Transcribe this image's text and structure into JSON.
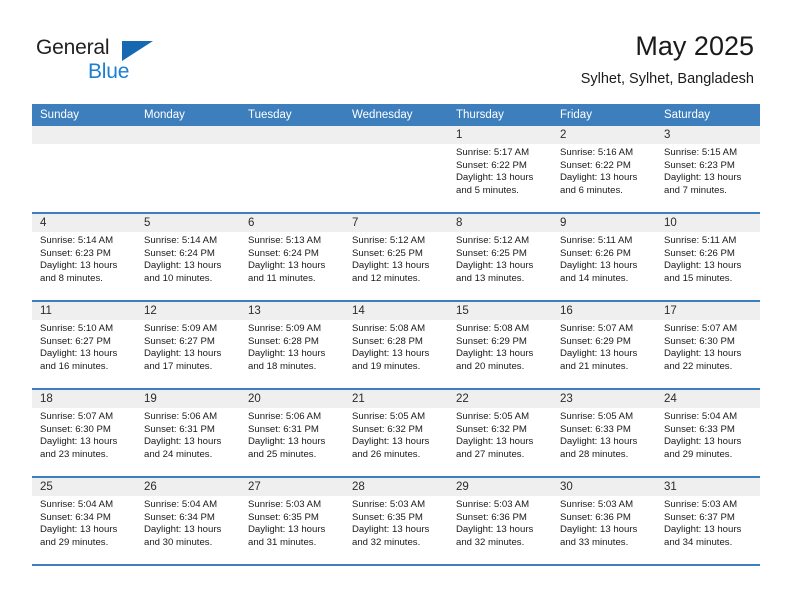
{
  "logo": {
    "word1": "General",
    "word2": "Blue",
    "triangle_color": "#1668b3",
    "blue_color": "#1b7fd4"
  },
  "header": {
    "title": "May 2025",
    "subtitle": "Sylhet, Sylhet, Bangladesh"
  },
  "theme": {
    "header_blue": "#3d7ebd",
    "daynum_strip": "#efefef",
    "cell_bg": "#ffffff"
  },
  "weekdays": [
    "Sunday",
    "Monday",
    "Tuesday",
    "Wednesday",
    "Thursday",
    "Friday",
    "Saturday"
  ],
  "labels": {
    "sunrise": "Sunrise:",
    "sunset": "Sunset:",
    "daylight": "Daylight:"
  },
  "weeks": [
    [
      {
        "day": "",
        "sunrise": "",
        "sunset": "",
        "daylight": ""
      },
      {
        "day": "",
        "sunrise": "",
        "sunset": "",
        "daylight": ""
      },
      {
        "day": "",
        "sunrise": "",
        "sunset": "",
        "daylight": ""
      },
      {
        "day": "",
        "sunrise": "",
        "sunset": "",
        "daylight": ""
      },
      {
        "day": "1",
        "sunrise": "Sunrise: 5:17 AM",
        "sunset": "Sunset: 6:22 PM",
        "daylight": "Daylight: 13 hours and 5 minutes."
      },
      {
        "day": "2",
        "sunrise": "Sunrise: 5:16 AM",
        "sunset": "Sunset: 6:22 PM",
        "daylight": "Daylight: 13 hours and 6 minutes."
      },
      {
        "day": "3",
        "sunrise": "Sunrise: 5:15 AM",
        "sunset": "Sunset: 6:23 PM",
        "daylight": "Daylight: 13 hours and 7 minutes."
      }
    ],
    [
      {
        "day": "4",
        "sunrise": "Sunrise: 5:14 AM",
        "sunset": "Sunset: 6:23 PM",
        "daylight": "Daylight: 13 hours and 8 minutes."
      },
      {
        "day": "5",
        "sunrise": "Sunrise: 5:14 AM",
        "sunset": "Sunset: 6:24 PM",
        "daylight": "Daylight: 13 hours and 10 minutes."
      },
      {
        "day": "6",
        "sunrise": "Sunrise: 5:13 AM",
        "sunset": "Sunset: 6:24 PM",
        "daylight": "Daylight: 13 hours and 11 minutes."
      },
      {
        "day": "7",
        "sunrise": "Sunrise: 5:12 AM",
        "sunset": "Sunset: 6:25 PM",
        "daylight": "Daylight: 13 hours and 12 minutes."
      },
      {
        "day": "8",
        "sunrise": "Sunrise: 5:12 AM",
        "sunset": "Sunset: 6:25 PM",
        "daylight": "Daylight: 13 hours and 13 minutes."
      },
      {
        "day": "9",
        "sunrise": "Sunrise: 5:11 AM",
        "sunset": "Sunset: 6:26 PM",
        "daylight": "Daylight: 13 hours and 14 minutes."
      },
      {
        "day": "10",
        "sunrise": "Sunrise: 5:11 AM",
        "sunset": "Sunset: 6:26 PM",
        "daylight": "Daylight: 13 hours and 15 minutes."
      }
    ],
    [
      {
        "day": "11",
        "sunrise": "Sunrise: 5:10 AM",
        "sunset": "Sunset: 6:27 PM",
        "daylight": "Daylight: 13 hours and 16 minutes."
      },
      {
        "day": "12",
        "sunrise": "Sunrise: 5:09 AM",
        "sunset": "Sunset: 6:27 PM",
        "daylight": "Daylight: 13 hours and 17 minutes."
      },
      {
        "day": "13",
        "sunrise": "Sunrise: 5:09 AM",
        "sunset": "Sunset: 6:28 PM",
        "daylight": "Daylight: 13 hours and 18 minutes."
      },
      {
        "day": "14",
        "sunrise": "Sunrise: 5:08 AM",
        "sunset": "Sunset: 6:28 PM",
        "daylight": "Daylight: 13 hours and 19 minutes."
      },
      {
        "day": "15",
        "sunrise": "Sunrise: 5:08 AM",
        "sunset": "Sunset: 6:29 PM",
        "daylight": "Daylight: 13 hours and 20 minutes."
      },
      {
        "day": "16",
        "sunrise": "Sunrise: 5:07 AM",
        "sunset": "Sunset: 6:29 PM",
        "daylight": "Daylight: 13 hours and 21 minutes."
      },
      {
        "day": "17",
        "sunrise": "Sunrise: 5:07 AM",
        "sunset": "Sunset: 6:30 PM",
        "daylight": "Daylight: 13 hours and 22 minutes."
      }
    ],
    [
      {
        "day": "18",
        "sunrise": "Sunrise: 5:07 AM",
        "sunset": "Sunset: 6:30 PM",
        "daylight": "Daylight: 13 hours and 23 minutes."
      },
      {
        "day": "19",
        "sunrise": "Sunrise: 5:06 AM",
        "sunset": "Sunset: 6:31 PM",
        "daylight": "Daylight: 13 hours and 24 minutes."
      },
      {
        "day": "20",
        "sunrise": "Sunrise: 5:06 AM",
        "sunset": "Sunset: 6:31 PM",
        "daylight": "Daylight: 13 hours and 25 minutes."
      },
      {
        "day": "21",
        "sunrise": "Sunrise: 5:05 AM",
        "sunset": "Sunset: 6:32 PM",
        "daylight": "Daylight: 13 hours and 26 minutes."
      },
      {
        "day": "22",
        "sunrise": "Sunrise: 5:05 AM",
        "sunset": "Sunset: 6:32 PM",
        "daylight": "Daylight: 13 hours and 27 minutes."
      },
      {
        "day": "23",
        "sunrise": "Sunrise: 5:05 AM",
        "sunset": "Sunset: 6:33 PM",
        "daylight": "Daylight: 13 hours and 28 minutes."
      },
      {
        "day": "24",
        "sunrise": "Sunrise: 5:04 AM",
        "sunset": "Sunset: 6:33 PM",
        "daylight": "Daylight: 13 hours and 29 minutes."
      }
    ],
    [
      {
        "day": "25",
        "sunrise": "Sunrise: 5:04 AM",
        "sunset": "Sunset: 6:34 PM",
        "daylight": "Daylight: 13 hours and 29 minutes."
      },
      {
        "day": "26",
        "sunrise": "Sunrise: 5:04 AM",
        "sunset": "Sunset: 6:34 PM",
        "daylight": "Daylight: 13 hours and 30 minutes."
      },
      {
        "day": "27",
        "sunrise": "Sunrise: 5:03 AM",
        "sunset": "Sunset: 6:35 PM",
        "daylight": "Daylight: 13 hours and 31 minutes."
      },
      {
        "day": "28",
        "sunrise": "Sunrise: 5:03 AM",
        "sunset": "Sunset: 6:35 PM",
        "daylight": "Daylight: 13 hours and 32 minutes."
      },
      {
        "day": "29",
        "sunrise": "Sunrise: 5:03 AM",
        "sunset": "Sunset: 6:36 PM",
        "daylight": "Daylight: 13 hours and 32 minutes."
      },
      {
        "day": "30",
        "sunrise": "Sunrise: 5:03 AM",
        "sunset": "Sunset: 6:36 PM",
        "daylight": "Daylight: 13 hours and 33 minutes."
      },
      {
        "day": "31",
        "sunrise": "Sunrise: 5:03 AM",
        "sunset": "Sunset: 6:37 PM",
        "daylight": "Daylight: 13 hours and 34 minutes."
      }
    ]
  ]
}
